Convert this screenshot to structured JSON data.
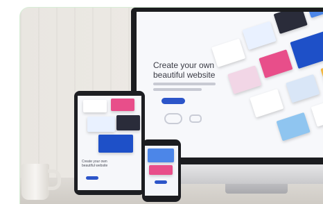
{
  "image": {
    "subject": "responsive-website-devices",
    "monitor": {
      "headline": "Create your own beautiful website"
    },
    "colors": {
      "wall": "#ece9e4",
      "frame_border": "#d7eed6",
      "device_bezel": "#1b1c1f",
      "accent_blue": "#2c55c9"
    }
  }
}
